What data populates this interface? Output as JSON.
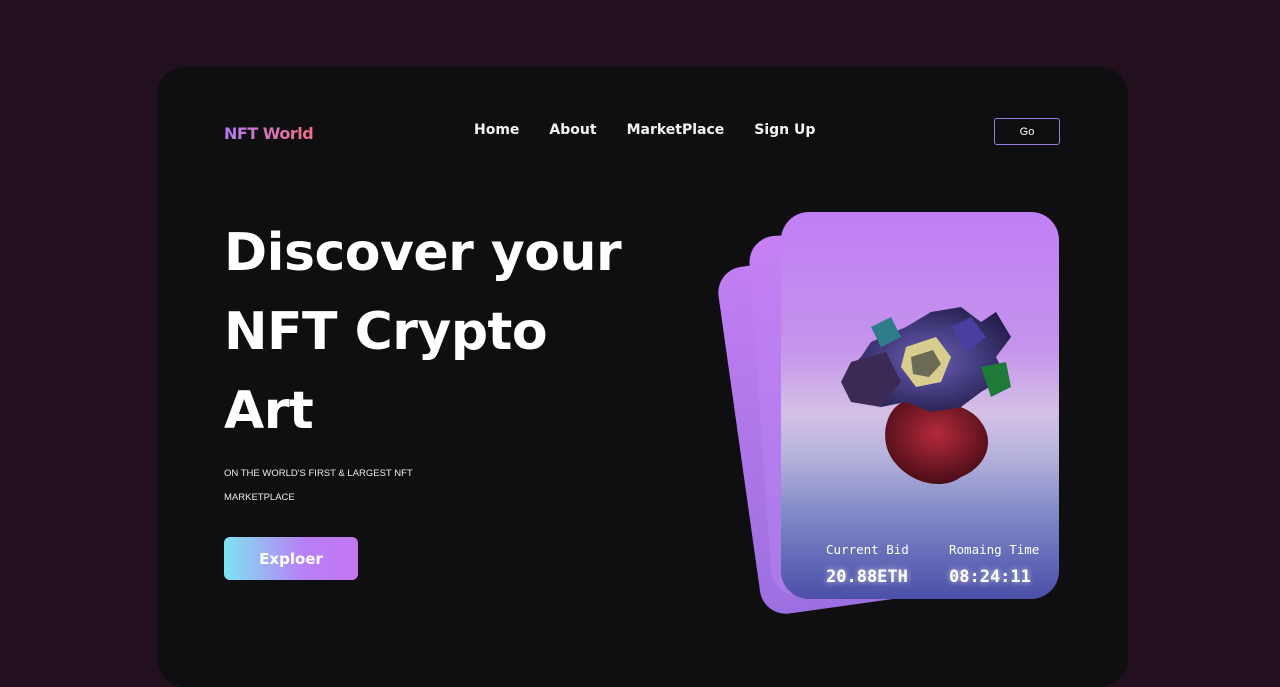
{
  "brand": {
    "logo_text": "NFT World",
    "gradient": [
      "#b57bf2",
      "#f06f83"
    ]
  },
  "nav": {
    "items": [
      {
        "label": "Home"
      },
      {
        "label": "About"
      },
      {
        "label": "MarketPlace"
      },
      {
        "label": "Sign Up"
      }
    ],
    "cta_label": "Go"
  },
  "hero": {
    "headline_line1": "Discover your",
    "headline_line2": "NFT Crypto",
    "headline_line3": "Art",
    "subtitle_line1": "ON THE WORLD'S FIRST & LARGEST NFT",
    "subtitle_line2": "MARKETPLACE",
    "button_label": "Exploer"
  },
  "card": {
    "bid_label": "Current Bid",
    "bid_value": "20.88ETH",
    "time_label": "Romaing Time",
    "time_value": "08:24:11"
  },
  "colors": {
    "page_background": "#22101f",
    "frame_background": "#0f0f11",
    "accent_purple": "#c17ef5",
    "accent_cyan": "#7fe3f2"
  }
}
